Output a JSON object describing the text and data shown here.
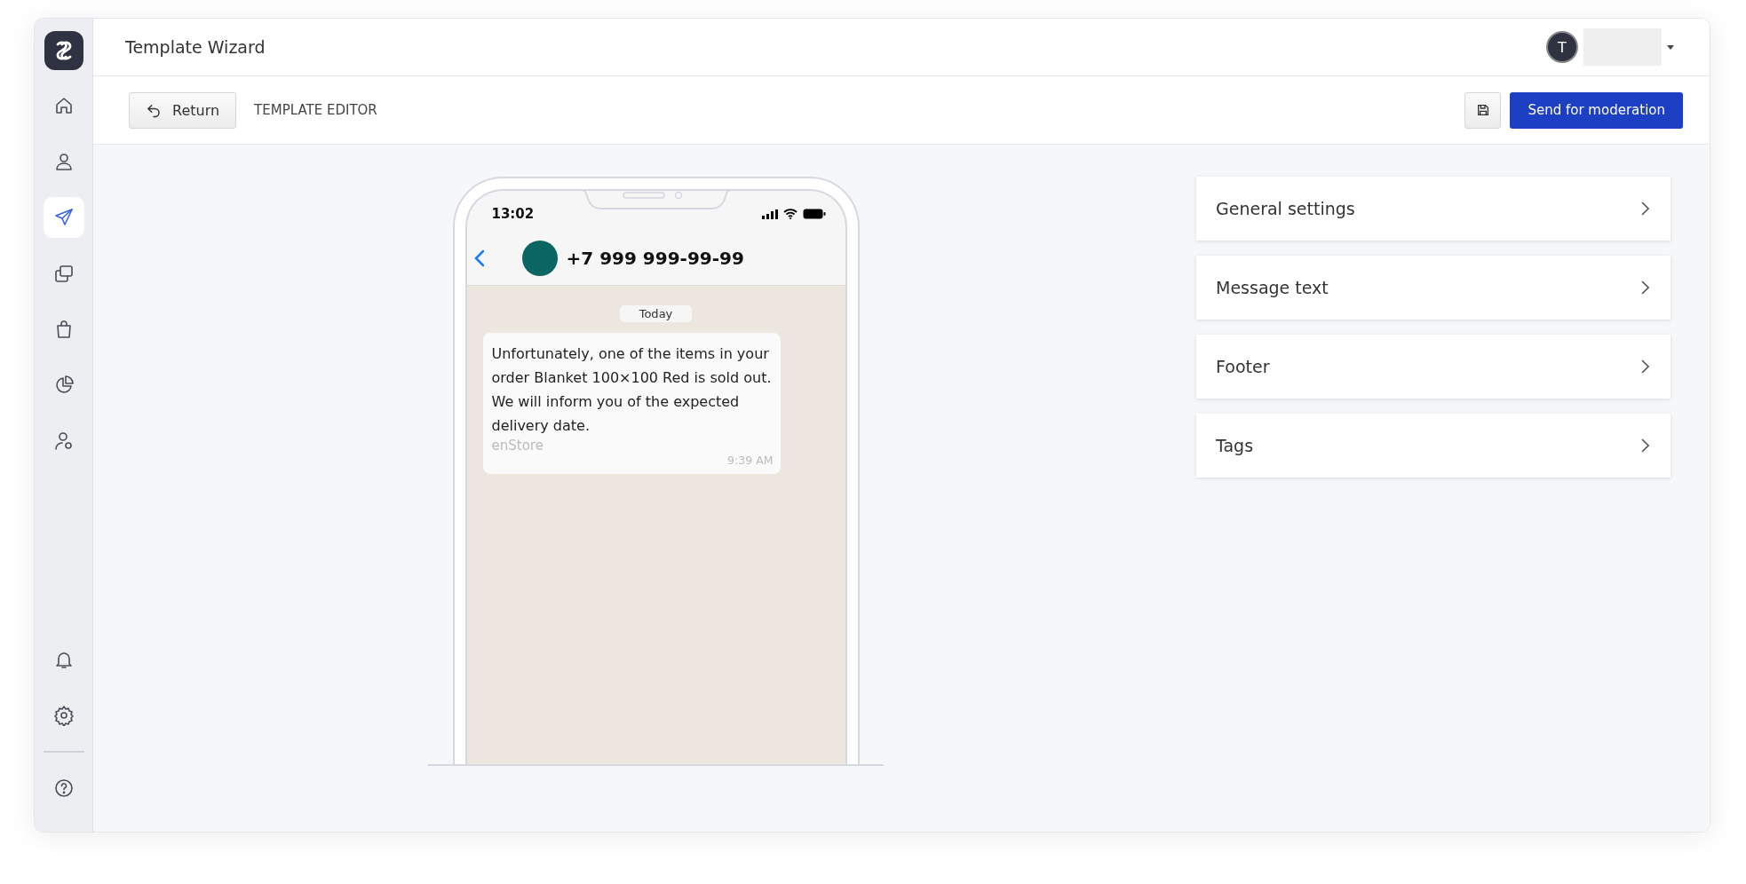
{
  "sidebar": {
    "items": [
      {
        "kind": "home",
        "selected": false
      },
      {
        "kind": "user",
        "selected": false
      },
      {
        "kind": "send",
        "selected": true
      },
      {
        "kind": "copy",
        "selected": false
      },
      {
        "kind": "bag",
        "selected": false
      },
      {
        "kind": "pie",
        "selected": false
      },
      {
        "kind": "user-settings",
        "selected": false
      }
    ],
    "bottom_items": [
      {
        "kind": "bell",
        "selected": false
      },
      {
        "kind": "gear",
        "selected": false
      },
      {
        "kind": "help",
        "selected": false
      }
    ]
  },
  "header": {
    "title": "Template Wizard",
    "user_initial": "T"
  },
  "toolbar": {
    "return_button": "Return",
    "section_title": "TEMPLATE EDITOR",
    "submit_button": "Send for moderation"
  },
  "phone": {
    "time": "13:02",
    "contact": "+7 999 999-99-99",
    "date_chip": "Today",
    "message": {
      "text": "Unfortunately, one of the items in your order Blanket 100×100 Red is sold out. We will inform you of the expected delivery date.",
      "sender": "enStore",
      "time": "9:39 AM"
    }
  },
  "settings_sections": [
    {
      "label": "General settings"
    },
    {
      "label": "Message text"
    },
    {
      "label": "Footer"
    },
    {
      "label": "Tags"
    }
  ]
}
